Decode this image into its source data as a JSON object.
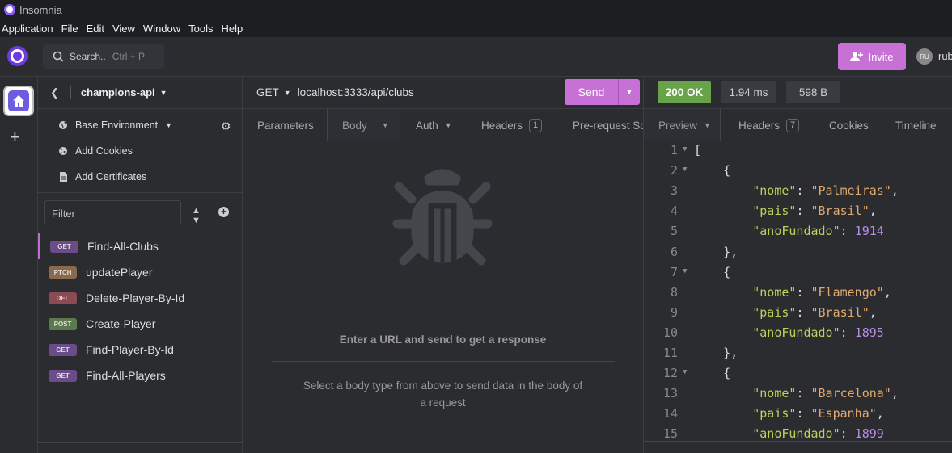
{
  "window": {
    "title": "Insomnia"
  },
  "menu": [
    "Application",
    "File",
    "Edit",
    "View",
    "Window",
    "Tools",
    "Help"
  ],
  "topbar": {
    "search_label": "Search..",
    "search_shortcut": "Ctrl + P",
    "invite_label": "Invite",
    "avatar_initials": "RU",
    "user_name": "rub"
  },
  "sidebar": {
    "project": "champions-api",
    "env_items": [
      "Base Environment",
      "Add Cookies",
      "Add Certificates"
    ],
    "filter_placeholder": "Filter",
    "requests": [
      {
        "method": "GET",
        "name": "Find-All-Clubs",
        "color": "#6b4c8a"
      },
      {
        "method": "PTCH",
        "name": "updatePlayer",
        "color": "#8a6a4c"
      },
      {
        "method": "DEL",
        "name": "Delete-Player-By-Id",
        "color": "#8a4c52"
      },
      {
        "method": "POST",
        "name": "Create-Player",
        "color": "#5a7a4c"
      },
      {
        "method": "GET",
        "name": "Find-Player-By-Id",
        "color": "#6b4c8a"
      },
      {
        "method": "GET",
        "name": "Find-All-Players",
        "color": "#6b4c8a"
      }
    ]
  },
  "request": {
    "method": "GET",
    "url": "localhost:3333/api/clubs",
    "send_label": "Send",
    "tabs": [
      "Parameters",
      "Body",
      "Auth",
      "Headers",
      "Pre-request Sc"
    ],
    "headers_count": "1",
    "empty_title": "Enter a URL and send to get a response",
    "empty_body": "Select a body type from above to send data in the body of a request"
  },
  "response": {
    "status": "200 OK",
    "time": "1.94 ms",
    "size": "598 B",
    "status_color": "#68a34a",
    "tabs": [
      "Preview",
      "Headers",
      "Cookies",
      "Timeline"
    ],
    "headers_count": "7",
    "lines": [
      {
        "n": "1",
        "fold": true,
        "parts": [
          [
            "p",
            "["
          ]
        ]
      },
      {
        "n": "2",
        "fold": true,
        "parts": [
          [
            "p",
            "    {"
          ]
        ]
      },
      {
        "n": "3",
        "fold": false,
        "parts": [
          [
            "p",
            "        "
          ],
          [
            "k",
            "\"nome\""
          ],
          [
            "p",
            ": "
          ],
          [
            "s",
            "\"Palmeiras\""
          ],
          [
            "p",
            ","
          ]
        ]
      },
      {
        "n": "4",
        "fold": false,
        "parts": [
          [
            "p",
            "        "
          ],
          [
            "k",
            "\"pais\""
          ],
          [
            "p",
            ": "
          ],
          [
            "s",
            "\"Brasil\""
          ],
          [
            "p",
            ","
          ]
        ]
      },
      {
        "n": "5",
        "fold": false,
        "parts": [
          [
            "p",
            "        "
          ],
          [
            "k",
            "\"anoFundado\""
          ],
          [
            "p",
            ": "
          ],
          [
            "n",
            "1914"
          ]
        ]
      },
      {
        "n": "6",
        "fold": false,
        "parts": [
          [
            "p",
            "    },"
          ]
        ]
      },
      {
        "n": "7",
        "fold": true,
        "parts": [
          [
            "p",
            "    {"
          ]
        ]
      },
      {
        "n": "8",
        "fold": false,
        "parts": [
          [
            "p",
            "        "
          ],
          [
            "k",
            "\"nome\""
          ],
          [
            "p",
            ": "
          ],
          [
            "s",
            "\"Flamengo\""
          ],
          [
            "p",
            ","
          ]
        ]
      },
      {
        "n": "9",
        "fold": false,
        "parts": [
          [
            "p",
            "        "
          ],
          [
            "k",
            "\"pais\""
          ],
          [
            "p",
            ": "
          ],
          [
            "s",
            "\"Brasil\""
          ],
          [
            "p",
            ","
          ]
        ]
      },
      {
        "n": "10",
        "fold": false,
        "parts": [
          [
            "p",
            "        "
          ],
          [
            "k",
            "\"anoFundado\""
          ],
          [
            "p",
            ": "
          ],
          [
            "n",
            "1895"
          ]
        ]
      },
      {
        "n": "11",
        "fold": false,
        "parts": [
          [
            "p",
            "    },"
          ]
        ]
      },
      {
        "n": "12",
        "fold": true,
        "parts": [
          [
            "p",
            "    {"
          ]
        ]
      },
      {
        "n": "13",
        "fold": false,
        "parts": [
          [
            "p",
            "        "
          ],
          [
            "k",
            "\"nome\""
          ],
          [
            "p",
            ": "
          ],
          [
            "s",
            "\"Barcelona\""
          ],
          [
            "p",
            ","
          ]
        ]
      },
      {
        "n": "14",
        "fold": false,
        "parts": [
          [
            "p",
            "        "
          ],
          [
            "k",
            "\"pais\""
          ],
          [
            "p",
            ": "
          ],
          [
            "s",
            "\"Espanha\""
          ],
          [
            "p",
            ","
          ]
        ]
      },
      {
        "n": "15",
        "fold": false,
        "parts": [
          [
            "p",
            "        "
          ],
          [
            "k",
            "\"anoFundado\""
          ],
          [
            "p",
            ": "
          ],
          [
            "n",
            "1899"
          ]
        ]
      }
    ]
  }
}
